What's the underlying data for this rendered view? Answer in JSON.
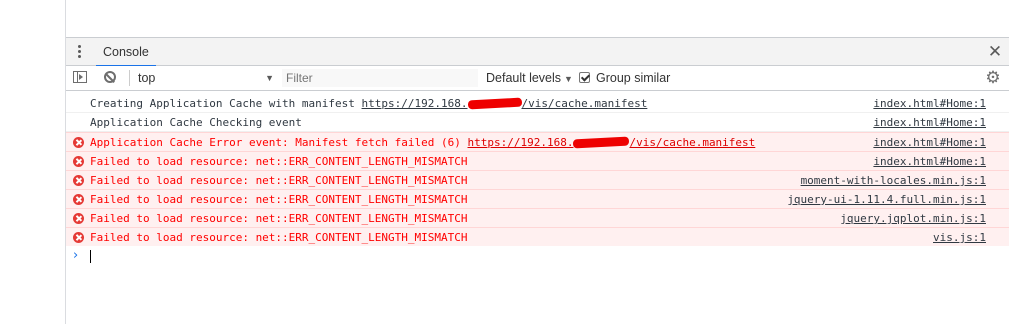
{
  "tabs": {
    "console_label": "Console"
  },
  "toolbar": {
    "context": "top",
    "filter_placeholder": "Filter",
    "levels_label": "Default levels",
    "group_similar_label": "Group similar",
    "group_similar_checked": true
  },
  "messages": [
    {
      "level": "info",
      "prefix": "Creating Application Cache with manifest ",
      "url_before": "https://192.168.",
      "url_after": "/vis/cache.manifest",
      "source": "index.html#Home:1"
    },
    {
      "level": "info",
      "text": "Application Cache Checking event",
      "source": "index.html#Home:1"
    },
    {
      "level": "error",
      "prefix": "Application Cache Error event: Manifest fetch failed (6) ",
      "url_before": "https://192.168.",
      "url_after": "/vis/cache.manifest",
      "source": "index.html#Home:1"
    },
    {
      "level": "error",
      "text": "Failed to load resource: net::ERR_CONTENT_LENGTH_MISMATCH",
      "source": "index.html#Home:1"
    },
    {
      "level": "error",
      "text": "Failed to load resource: net::ERR_CONTENT_LENGTH_MISMATCH",
      "source": "moment-with-locales.min.js:1"
    },
    {
      "level": "error",
      "text": "Failed to load resource: net::ERR_CONTENT_LENGTH_MISMATCH",
      "source": "jquery-ui-1.11.4.full.min.js:1"
    },
    {
      "level": "error",
      "text": "Failed to load resource: net::ERR_CONTENT_LENGTH_MISMATCH",
      "source": "jquery.jqplot.min.js:1"
    },
    {
      "level": "error",
      "text": "Failed to load resource: net::ERR_CONTENT_LENGTH_MISMATCH",
      "source": "vis.js:1"
    }
  ],
  "icons": {
    "menu": "kebab-menu-icon",
    "close": "close-icon",
    "sidebar": "sidebar-toggle-icon",
    "clear": "clear-console-icon",
    "settings": "gear-icon",
    "error": "error-icon",
    "prompt": "prompt-chevron-icon"
  },
  "colors": {
    "error_text": "#ff0000",
    "error_bg": "#fff0f0",
    "accent": "#1a73e8"
  }
}
